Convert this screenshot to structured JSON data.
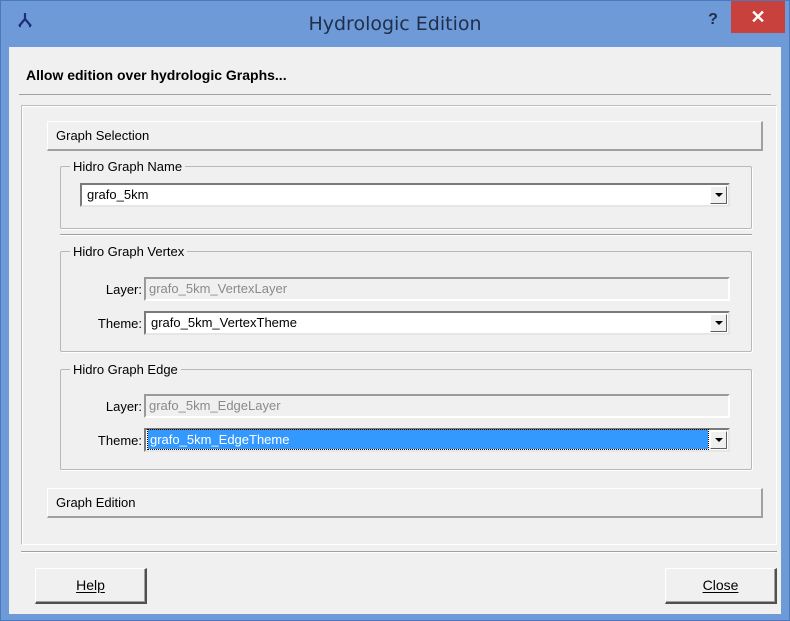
{
  "window": {
    "title": "Hydrologic Edition",
    "help_glyph": "?",
    "close_glyph": "✕",
    "app_icon": "hydro-app-icon"
  },
  "header": {
    "text": "Allow edition over hydrologic Graphs..."
  },
  "graph_selection": {
    "section_label": "Graph Selection",
    "name_group": {
      "legend": "Hidro Graph Name",
      "selected_value": "grafo_5km"
    },
    "vertex_group": {
      "legend": "Hidro Graph Vertex",
      "layer_label": "Layer:",
      "layer_value": "grafo_5km_VertexLayer",
      "theme_label": "Theme:",
      "theme_value": "grafo_5km_VertexTheme"
    },
    "edge_group": {
      "legend": "Hidro Graph Edge",
      "layer_label": "Layer:",
      "layer_value": "grafo_5km_EdgeLayer",
      "theme_label": "Theme:",
      "theme_value": "grafo_5km_EdgeTheme"
    }
  },
  "graph_edition": {
    "section_label": "Graph Edition"
  },
  "footer": {
    "help_label": "Help",
    "close_label": "Close"
  },
  "colors": {
    "titlebar": "#6f9ad8",
    "close_button": "#c8413c",
    "selection": "#3399ff",
    "dialog_face": "#f0f0f0"
  }
}
